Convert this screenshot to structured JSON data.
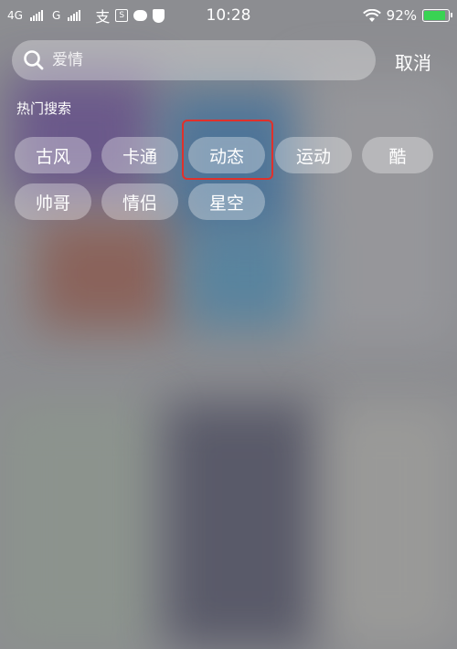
{
  "status_bar": {
    "network1": "4G",
    "network2": "G",
    "time": "10:28",
    "battery_text": "92%",
    "battery_level": 0.92,
    "alipay_glyph": "支",
    "box_glyph": "S"
  },
  "search": {
    "placeholder": "爱情",
    "cancel_label": "取消"
  },
  "hot_search": {
    "title": "热门搜索",
    "row1": [
      "古风",
      "卡通",
      "动态",
      "运动",
      "酷"
    ],
    "row2": [
      "帅哥",
      "情侣",
      "星空"
    ]
  },
  "colors": {
    "highlight": "#e0312b",
    "battery_fill": "#39d353"
  }
}
